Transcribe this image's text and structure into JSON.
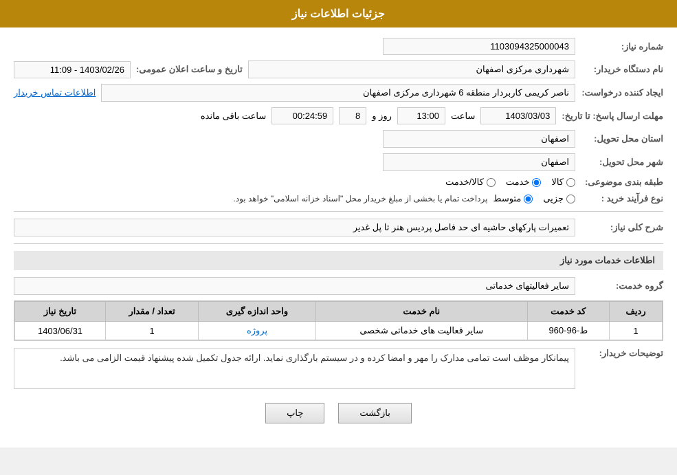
{
  "header": {
    "title": "جزئیات اطلاعات نیاز"
  },
  "fields": {
    "need_number_label": "شماره نیاز:",
    "need_number_value": "1103094325000043",
    "buyer_org_label": "نام دستگاه خریدار:",
    "buyer_org_value": "شهرداری مرکزی اصفهان",
    "announce_date_label": "تاریخ و ساعت اعلان عمومی:",
    "announce_date_value": "1403/02/26 - 11:09",
    "creator_label": "ایجاد کننده درخواست:",
    "creator_value": "ناصر کریمی کاربردار منطقه 6 شهرداری مرکزی اصفهان",
    "contact_link": "اطلاعات تماس خریدار",
    "reply_deadline_label": "مهلت ارسال پاسخ: تا تاریخ:",
    "reply_date": "1403/03/03",
    "reply_time_label": "ساعت",
    "reply_time": "13:00",
    "reply_days_label": "روز و",
    "reply_days": "8",
    "reply_remaining_label": "ساعت باقی مانده",
    "reply_remaining": "00:24:59",
    "province_label": "استان محل تحویل:",
    "province_value": "اصفهان",
    "city_label": "شهر محل تحویل:",
    "city_value": "اصفهان",
    "category_label": "طبقه بندی موضوعی:",
    "category_options": [
      "کالا",
      "خدمت",
      "کالا/خدمت"
    ],
    "category_selected": "خدمت",
    "purchase_type_label": "نوع فرآیند خرید :",
    "purchase_type_options": [
      "جزیی",
      "متوسط"
    ],
    "purchase_type_note": "پرداخت تمام یا بخشی از مبلغ خریدار محل \"اسناد خزانه اسلامی\" خواهد بود.",
    "need_description_label": "شرح کلی نیاز:",
    "need_description_value": "تعمیرات پارکهای حاشیه ای حد فاصل پردیس هنر تا پل غدیر",
    "services_section_title": "اطلاعات خدمات مورد نیاز",
    "service_group_label": "گروه خدمت:",
    "service_group_value": "سایر فعالیتهای خدماتی"
  },
  "table": {
    "headers": [
      "ردیف",
      "کد خدمت",
      "نام خدمت",
      "واحد اندازه گیری",
      "تعداد / مقدار",
      "تاریخ نیاز"
    ],
    "rows": [
      {
        "row": "1",
        "code": "ط-96-960",
        "name": "سایر فعالیت های خدماتی شخصی",
        "unit": "پروژه",
        "quantity": "1",
        "date": "1403/06/31"
      }
    ]
  },
  "notes": {
    "label": "توضیحات خریدار:",
    "value": "پیمانکار موظف است تمامی مدارک را مهر و امضا کرده و در سیستم بارگذاری نماید. ارائه جدول تکمیل شده پیشنهاد قیمت الزامی می باشد."
  },
  "buttons": {
    "back": "بازگشت",
    "print": "چاپ"
  }
}
